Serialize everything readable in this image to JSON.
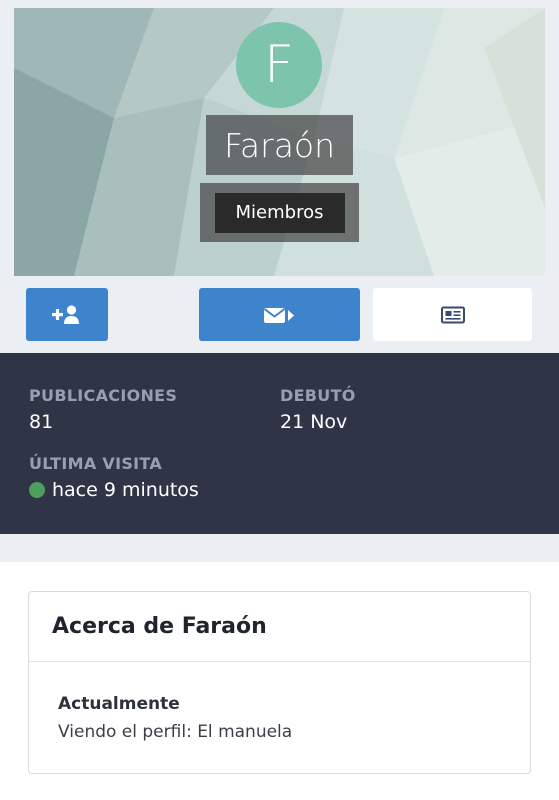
{
  "profile": {
    "avatar_letter": "F",
    "name": "Faraón",
    "role": "Miembros"
  },
  "actions": {
    "follow_icon": "add-user-icon",
    "message_icon": "envelope-icon",
    "posts_icon": "newspaper-icon"
  },
  "stats": {
    "posts_label": "PUBLICACIONES",
    "posts_value": "81",
    "debut_label": "DEBUTÓ",
    "debut_value": "21 Nov",
    "last_visit_label": "ÚLTIMA VISITA",
    "last_visit_value": "hace 9 minutos"
  },
  "about": {
    "title": "Acerca de Faraón",
    "currently_label": "Actualmente",
    "currently_value": "Viendo el perfil: El manuela"
  },
  "colors": {
    "accent": "#3d84cc",
    "avatar": "#7cc4ab",
    "stats_bg": "#2f3547",
    "online": "#4e9f5c"
  }
}
